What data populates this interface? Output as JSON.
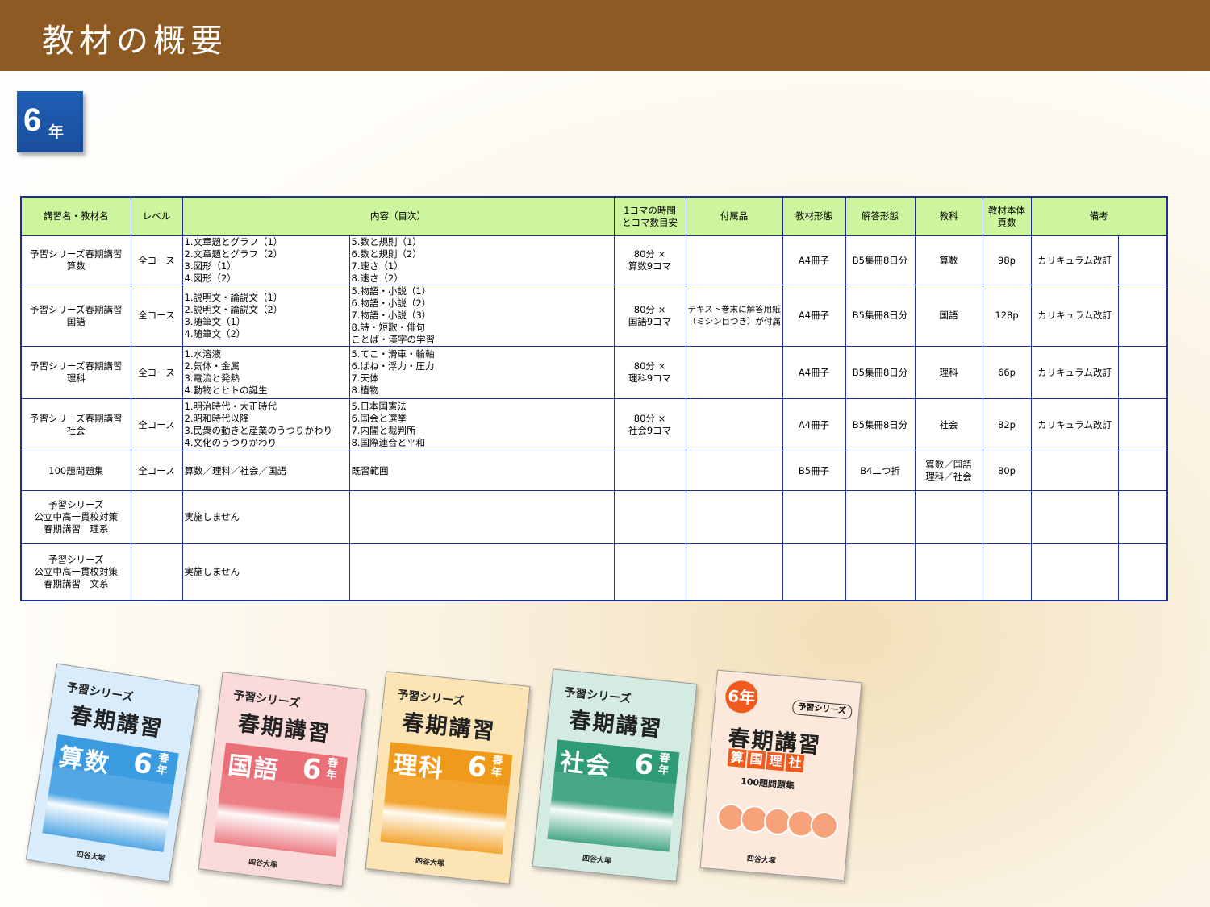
{
  "header": {
    "title": "教材の概要"
  },
  "grade_badge": {
    "number": "6",
    "suffix": "年"
  },
  "table": {
    "headers": [
      "講習名・教材名",
      "レベル",
      "内容（目次）",
      "1コマの時間とコマ数目安",
      "付属品",
      "教材形態",
      "解答形態",
      "教科",
      "教材本体頁数",
      "備考"
    ],
    "header_lines": {
      "time": [
        "1コマの時間",
        "とコマ数目安"
      ],
      "pages": [
        "教材本体",
        "頁数"
      ]
    },
    "rows": [
      {
        "name": [
          "予習シリーズ春期講習",
          "算数"
        ],
        "level": "全コース",
        "content_left": [
          "1.文章題とグラフ（1）",
          "2.文章題とグラフ（2）",
          "3.図形（1）",
          "4.図形（2）"
        ],
        "content_right": [
          "5.数と規則（1）",
          "6.数と規則（2）",
          "7.速さ（1）",
          "8.速さ（2）"
        ],
        "time": [
          "80分 ×",
          "算数9コマ"
        ],
        "accessories": [],
        "format": "A4冊子",
        "answer": "B5集冊8日分",
        "subject": [
          "算数"
        ],
        "pages": "98p",
        "note": "カリキュラム改訂"
      },
      {
        "name": [
          "予習シリーズ春期講習",
          "国語"
        ],
        "level": "全コース",
        "content_left": [
          "1.説明文・論説文（1）",
          "2.説明文・論説文（2）",
          "3.随筆文（1）",
          "4.随筆文（2）"
        ],
        "content_right": [
          "5.物語・小説（1）",
          "6.物語・小説（2）",
          "7.物語・小説（3）",
          "8.詩・短歌・俳句",
          "ことば・漢字の学習"
        ],
        "time": [
          "80分 ×",
          "国語9コマ"
        ],
        "accessories": [
          "テキスト巻末に解答用紙",
          "（ミシン目つき）が付属"
        ],
        "format": "A4冊子",
        "answer": "B5集冊8日分",
        "subject": [
          "国語"
        ],
        "pages": "128p",
        "note": "カリキュラム改訂"
      },
      {
        "name": [
          "予習シリーズ春期講習",
          "理科"
        ],
        "level": "全コース",
        "content_left": [
          "1.水溶液",
          "2.気体・金属",
          "3.電流と発熱",
          "4.動物とヒトの誕生"
        ],
        "content_right": [
          "5.てこ・滑車・輪軸",
          "6.ばね・浮力・圧力",
          "7.天体",
          "8.植物"
        ],
        "time": [
          "80分 ×",
          "理科9コマ"
        ],
        "accessories": [],
        "format": "A4冊子",
        "answer": "B5集冊8日分",
        "subject": [
          "理科"
        ],
        "pages": "66p",
        "note": "カリキュラム改訂"
      },
      {
        "name": [
          "予習シリーズ春期講習",
          "社会"
        ],
        "level": "全コース",
        "content_left": [
          "1.明治時代・大正時代",
          "2.昭和時代以降",
          "3.民衆の動きと産業のうつりかわり",
          "4.文化のうつりかわり"
        ],
        "content_right": [
          "5.日本国憲法",
          "6.国会と選挙",
          "7.内閣と裁判所",
          "8.国際連合と平和"
        ],
        "time": [
          "80分 ×",
          "社会9コマ"
        ],
        "accessories": [],
        "format": "A4冊子",
        "answer": "B5集冊8日分",
        "subject": [
          "社会"
        ],
        "pages": "82p",
        "note": "カリキュラム改訂"
      },
      {
        "name": [
          "100題問題集"
        ],
        "level": "全コース",
        "content_left": [
          "算数／理科／社会／国語"
        ],
        "content_right": [
          "既習範囲"
        ],
        "time": [],
        "accessories": [],
        "format": "B5冊子",
        "answer": "B4二つ折",
        "subject": [
          "算数／国語",
          "理科／社会"
        ],
        "pages": "80p",
        "note": ""
      },
      {
        "name": [
          "予習シリーズ",
          "公立中高一貫校対策",
          "春期講習　理系"
        ],
        "level": "",
        "content_left": [
          "実施しません"
        ],
        "content_right": [],
        "time": [],
        "accessories": [],
        "format": "",
        "answer": "",
        "subject": [],
        "pages": "",
        "note": ""
      },
      {
        "name": [
          "予習シリーズ",
          "公立中高一貫校対策",
          "春期講習　文系"
        ],
        "level": "",
        "content_left": [
          "実施しません"
        ],
        "content_right": [],
        "time": [],
        "accessories": [],
        "format": "",
        "answer": "",
        "subject": [],
        "pages": "",
        "note": ""
      }
    ]
  },
  "books": [
    {
      "series": "予習シリーズ",
      "title": "春期講習",
      "subject": "算数",
      "grade": "6",
      "season": [
        "春",
        "年"
      ],
      "publisher": "四谷大塚",
      "color": "#3b9be0",
      "cover": "#d9ecfb"
    },
    {
      "series": "予習シリーズ",
      "title": "春期講習",
      "subject": "国語",
      "grade": "6",
      "season": [
        "春",
        "年"
      ],
      "publisher": "四谷大塚",
      "color": "#ea6f76",
      "cover": "#fbdada"
    },
    {
      "series": "予習シリーズ",
      "title": "春期講習",
      "subject": "理科",
      "grade": "6",
      "season": [
        "春",
        "年"
      ],
      "publisher": "四谷大塚",
      "color": "#f09a1c",
      "cover": "#fde4b5"
    },
    {
      "series": "予習シリーズ",
      "title": "春期講習",
      "subject": "社会",
      "grade": "6",
      "season": [
        "春",
        "年"
      ],
      "publisher": "四谷大塚",
      "color": "#2f9b78",
      "cover": "#d3ebe1"
    }
  ],
  "book5": {
    "badge": "6年",
    "series": "予習シリーズ",
    "title": "春期講習",
    "subjects": [
      "算",
      "国",
      "理",
      "社"
    ],
    "caption": "100題問題集",
    "publisher": "四谷大塚",
    "color": "#ef5a1e",
    "cover": "#fde8dc"
  }
}
